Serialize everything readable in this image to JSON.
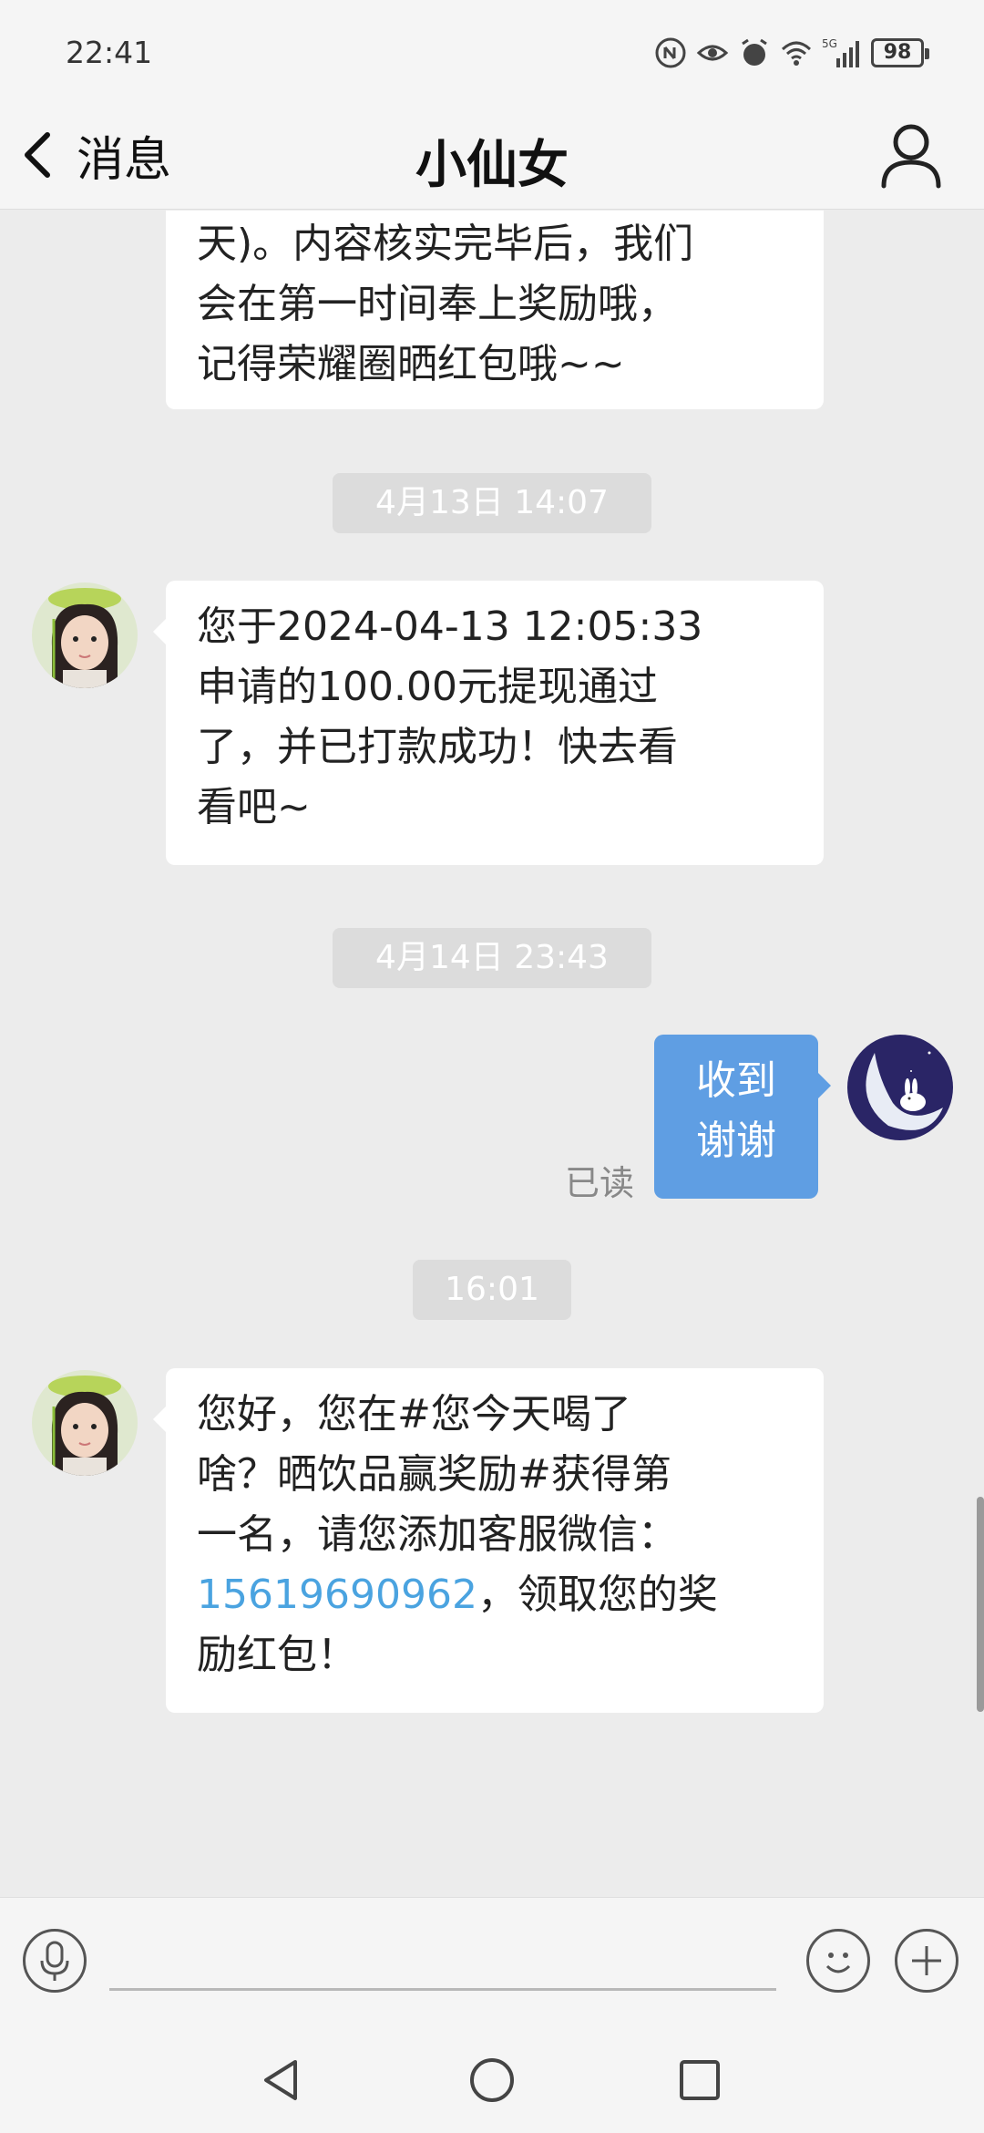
{
  "status_bar": {
    "time": "22:41",
    "network": "5G",
    "battery": "98"
  },
  "header": {
    "back_label": "消息",
    "title": "小仙女",
    "back_icon": "chevron-left-icon",
    "profile_icon": "person-icon"
  },
  "messages": [
    {
      "sender": "contact",
      "lines": [
        "天)。内容核实完毕后，我们",
        "会在第一时间奉上奖励哦，",
        "记得荣耀圈晒红包哦~~"
      ]
    },
    {
      "timestamp": "4月13日 14:07"
    },
    {
      "sender": "contact",
      "lines": [
        "您于2024-04-13 12:05:33",
        "申请的100.00元提现通过",
        "了，并已打款成功！快去看",
        "看吧~"
      ]
    },
    {
      "timestamp": "4月14日 23:43"
    },
    {
      "sender": "me",
      "lines": [
        "收到",
        "谢谢"
      ],
      "status": "已读"
    },
    {
      "timestamp": "16:01"
    },
    {
      "sender": "contact",
      "lines": [
        "您好，您在#您今天喝了",
        "啥？晒饮品赢奖励#获得第",
        "一名，请您添加客服微信：",
        "，领取您的奖",
        "励红包！"
      ],
      "phone_link": "15619690962"
    }
  ],
  "input_bar": {
    "voice_icon": "microphone-icon",
    "emoji_icon": "smiley-icon",
    "add_icon": "plus-icon",
    "placeholder": ""
  },
  "nav_bar": {
    "back_icon": "triangle-back-icon",
    "home_icon": "circle-home-icon",
    "recents_icon": "square-recents-icon"
  },
  "colors": {
    "background": "#ececec",
    "my_bubble": "#5f9ee3",
    "link": "#4aa3e0",
    "time_pill": "#dcdcdc"
  }
}
